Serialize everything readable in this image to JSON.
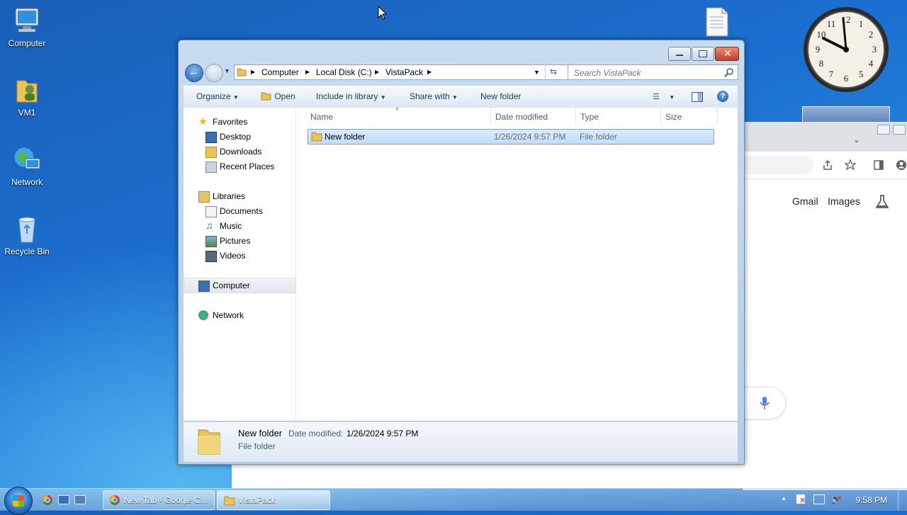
{
  "desktop": {
    "icons": [
      {
        "label": "Computer"
      },
      {
        "label": "VM1"
      },
      {
        "label": "Network"
      },
      {
        "label": "Recycle Bin"
      }
    ]
  },
  "clock_gadget": {
    "numbers": [
      "12",
      "1",
      "2",
      "3",
      "4",
      "5",
      "6",
      "7",
      "8",
      "9",
      "10",
      "11"
    ]
  },
  "chrome": {
    "links": {
      "gmail": "Gmail",
      "images": "Images"
    }
  },
  "explorer": {
    "breadcrumb": [
      "Computer",
      "Local Disk (C:)",
      "VistaPack"
    ],
    "search_placeholder": "Search VistaPack",
    "toolbar": {
      "organize": "Organize",
      "open": "Open",
      "include_in_library": "Include in library",
      "share_with": "Share with",
      "new_folder": "New folder"
    },
    "nav": {
      "favorites": "Favorites",
      "desktop": "Desktop",
      "downloads": "Downloads",
      "recent_places": "Recent Places",
      "libraries": "Libraries",
      "documents": "Documents",
      "music": "Music",
      "pictures": "Pictures",
      "videos": "Videos",
      "computer": "Computer",
      "network": "Network"
    },
    "columns": {
      "name": "Name",
      "date_modified": "Date modified",
      "type": "Type",
      "size": "Size"
    },
    "files": [
      {
        "name": "New folder",
        "date_modified": "1/26/2024 9:57 PM",
        "type": "File folder",
        "size": ""
      }
    ],
    "details": {
      "name": "New folder",
      "date_label": "Date modified:",
      "date_value": "1/26/2024 9:57 PM",
      "type": "File folder"
    }
  },
  "taskbar": {
    "buttons": [
      {
        "label": "New Tab - Google C..."
      },
      {
        "label": "VistaPack"
      }
    ],
    "time": "9:58 PM"
  }
}
